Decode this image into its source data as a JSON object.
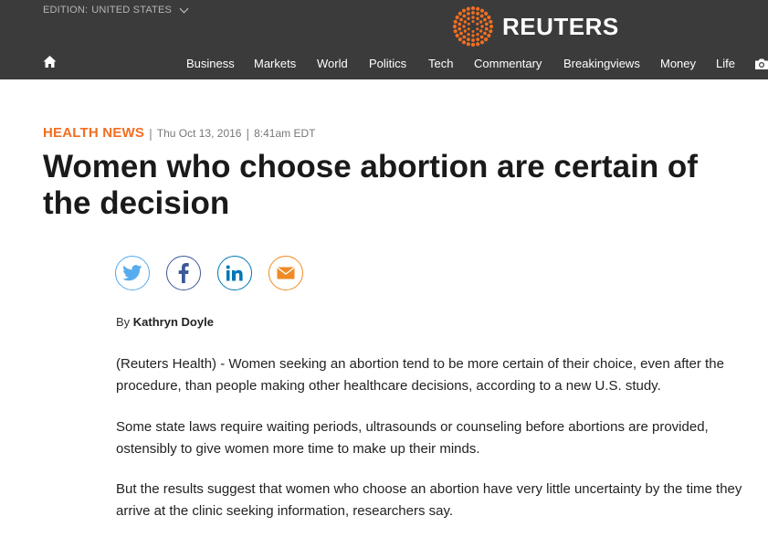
{
  "header": {
    "edition_prefix": "EDITION:",
    "edition_value": "UNITED STATES",
    "brand": "REUTERS",
    "brand_color": "#f26e21",
    "background": "#3b3b3b",
    "home_icon": "home-icon",
    "camera_icon": "camera-icon"
  },
  "nav": {
    "items": [
      "Business",
      "Markets",
      "World",
      "Politics",
      "Tech",
      "Commentary",
      "Breakingviews",
      "Money",
      "Life"
    ]
  },
  "article": {
    "section": "HEALTH NEWS",
    "date": "Thu Oct 13, 2016",
    "time": "8:41am EDT",
    "headline": "Women who choose abortion are certain of the decision",
    "byline_prefix": "By",
    "author": "Kathryn Doyle",
    "paragraphs": [
      "(Reuters Health) - Women seeking an abortion tend to be more certain of their choice, even after the procedure, than people making other healthcare decisions, according to a new U.S. study.",
      "Some state laws require waiting periods, ultrasounds or counseling before abortions are provided, ostensibly to give women more time to make up their minds.",
      "But the results suggest that women who choose an abortion have very little uncertainty by the time they arrive at the clinic seeking information, researchers say."
    ]
  },
  "share": {
    "icons": [
      "twitter-icon",
      "facebook-icon",
      "linkedin-icon",
      "email-icon"
    ],
    "colors": {
      "twitter": "#55acee",
      "facebook": "#3b5998",
      "linkedin": "#0077b5",
      "email": "#f08a24"
    }
  }
}
